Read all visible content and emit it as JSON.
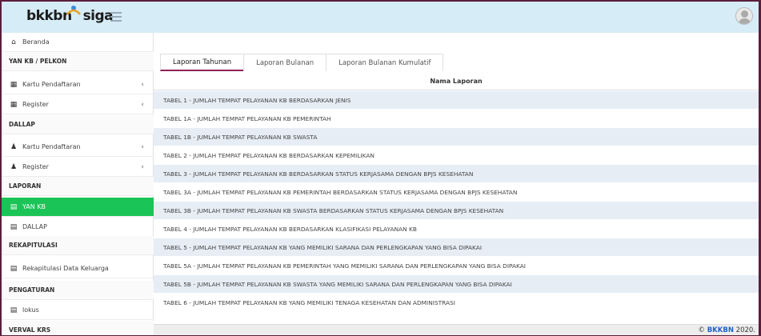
{
  "brand": {
    "name": "bkkbn",
    "suffix": "siga"
  },
  "colors": {
    "header": "#d6ecf6",
    "frame": "#5c1d3d",
    "active": "#1bc456",
    "accent": "#8e2456",
    "alt_row": "#e6edf5",
    "link": "#1e62c9"
  },
  "sidebar": {
    "beranda": "Beranda",
    "sec_yankb": "YAN KB / PELKON",
    "kartu1": "Kartu Pendaftaran",
    "register1": "Register",
    "sec_dallap": "DALLAP",
    "kartu2": "Kartu Pendaftaran",
    "register2": "Register",
    "sec_laporan": "LAPORAN",
    "yankb": "YAN KB",
    "dallap": "DALLAP",
    "sec_rekap": "REKAPITULASI",
    "rekap": "Rekapitulasi Data Keluarga",
    "sec_pengaturan": "PENGATURAN",
    "lokus": "lokus",
    "sec_verval": "VERVAL KRS"
  },
  "tabs": [
    "Laporan Tahunan",
    "Laporan Bulanan",
    "Laporan Bulanan Kumulatif"
  ],
  "table": {
    "header": "Nama Laporan",
    "rows": [
      "TABEL 1 - JUMLAH TEMPAT PELAYANAN KB BERDASARKAN JENIS",
      "TABEL 1A - JUMLAH TEMPAT PELAYANAN KB PEMERINTAH",
      "TABEL 1B - JUMLAH TEMPAT PELAYANAN KB SWASTA",
      "TABEL 2 - JUMLAH TEMPAT PELAYANAN KB BERDASARKAN KEPEMILIKAN",
      "TABEL 3 - JUMLAH TEMPAT PELAYANAN KB BERDASARKAN STATUS KERJASAMA DENGAN BPJS KESEHATAN",
      "TABEL 3A - JUMLAH TEMPAT PELAYANAN KB PEMERINTAH BERDASARKAN STATUS KERJASAMA DENGAN BPJS KESEHATAN",
      "TABEL 3B - JUMLAH TEMPAT PELAYANAN KB SWASTA BERDASARKAN STATUS KERJASAMA DENGAN BPJS KESEHATAN",
      "TABEL 4 - JUMLAH TEMPAT PELAYANAN KB BERDASARKAN KLASIFIKASI PELAYANAN KB",
      "TABEL 5 - JUMLAH TEMPAT PELAYANAN KB YANG MEMILIKI SARANA DAN PERLENGKAPAN YANG BISA DIPAKAI",
      "TABEL 5A - JUMLAH TEMPAT PELAYANAN KB PEMERINTAH YANG MEMILIKI SARANA DAN PERLENGKAPAN YANG BISA DIPAKAI",
      "TABEL 5B - JUMLAH TEMPAT PELAYANAN KB SWASTA YANG MEMILIKI SARANA DAN PERLENGKAPAN YANG BISA DIPAKAI",
      "TABEL 6 - JUMLAH TEMPAT PELAYANAN KB YANG MEMILIKI TENAGA KESEHATAN DAN ADMINISTRASI"
    ]
  },
  "footer": {
    "copy": "©",
    "org": "BKKBN",
    "year": "2020."
  }
}
